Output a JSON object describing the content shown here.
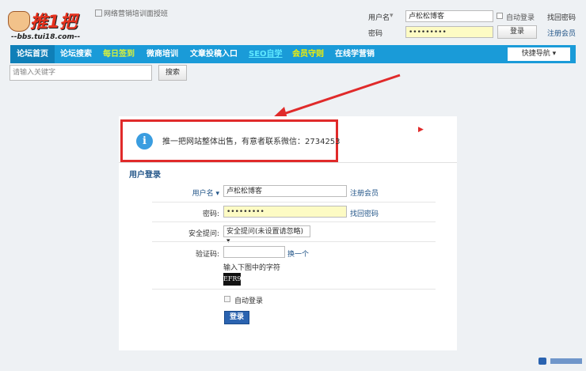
{
  "header": {
    "logo_text": "推1把",
    "logo_url": "--bbs.tui18.com--",
    "banner_alt": "网络营销培训面授班",
    "login": {
      "username_label": "用户名",
      "username_value": "卢松松博客",
      "password_label": "密码",
      "password_value": "•••••••••",
      "auto_login": "自动登录",
      "find_password": "找回密码",
      "login_button": "登录",
      "register": "注册会员"
    }
  },
  "nav": {
    "items": [
      {
        "label": "论坛首页",
        "color": "#ffffff"
      },
      {
        "label": "论坛搜索",
        "color": "#ffffff"
      },
      {
        "label": "每日签到",
        "color": "#d8f03c"
      },
      {
        "label": "微商培训",
        "color": "#ffffff"
      },
      {
        "label": "文章投稿入口",
        "color": "#ffffff"
      },
      {
        "label": "SEO自学",
        "color": "#5fe8ff"
      },
      {
        "label": "会员守则",
        "color": "#f6f000"
      },
      {
        "label": "在线学营销",
        "color": "#ffffff"
      }
    ],
    "quick_nav": "快捷导航 ▾"
  },
  "search": {
    "placeholder": "请输入关键字",
    "button": "搜索"
  },
  "notice": {
    "text": "推一把网站整体出售，有意者联系微信：2734253"
  },
  "form": {
    "title": "用户登录",
    "username_label": "用户名 ▾",
    "username_value": "卢松松博客",
    "register": "注册会员",
    "password_label": "密码:",
    "password_value": "•••••••••",
    "find_password": "找回密码",
    "question_label": "安全提问:",
    "question_value": "安全提问(未设置请忽略) ▾",
    "captcha_label": "验证码:",
    "captcha_value": "",
    "captcha_refresh": "换一个",
    "captcha_hint": "输入下图中的字符",
    "captcha_image_text": "EFR9",
    "auto_login": "自动登录",
    "login_button": "登录"
  },
  "colors": {
    "nav": "#1a9bd8",
    "notice_border": "#e02a2a",
    "button": "#2a63b0"
  }
}
